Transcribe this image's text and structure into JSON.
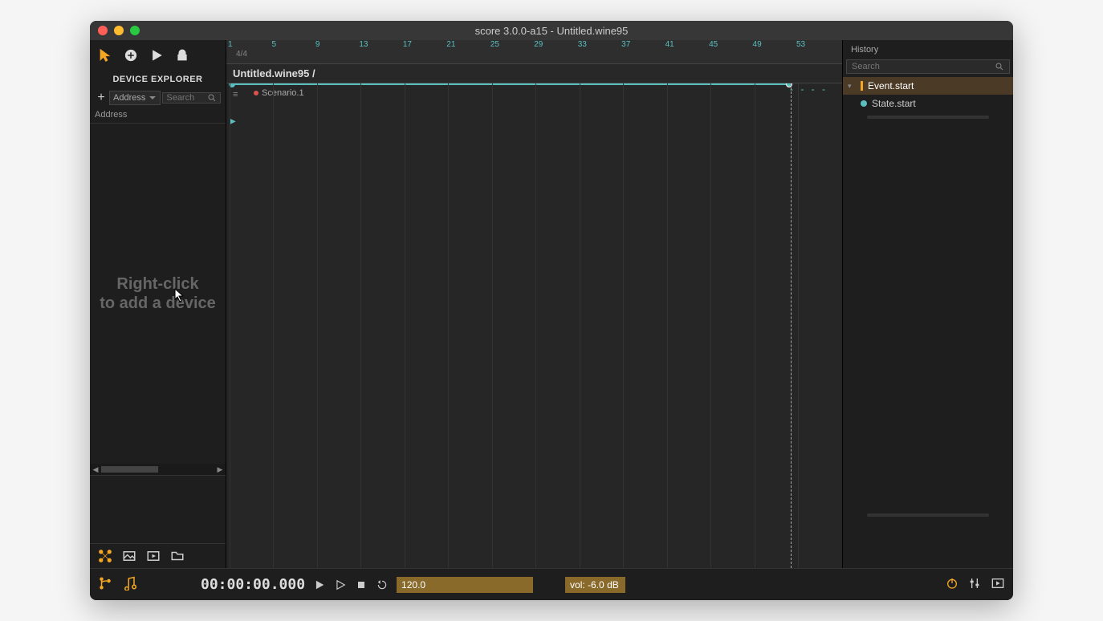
{
  "window": {
    "title": "score 3.0.0-a15 - Untitled.wine95"
  },
  "left": {
    "panel_title": "DEVICE EXPLORER",
    "address_label": "Address",
    "address_header": "Address",
    "search_placeholder": "Search",
    "hint_line1": "Right-click",
    "hint_line2": "to add a device"
  },
  "timeline": {
    "time_sig": "4/4",
    "ruler_ticks": [
      "1",
      "5",
      "9",
      "13",
      "17",
      "21",
      "25",
      "29",
      "33",
      "37",
      "41",
      "45",
      "49",
      "53"
    ],
    "title": "Untitled.wine95 /",
    "scenario_label": "Scenario.1"
  },
  "right": {
    "header": "History",
    "search_placeholder": "Search",
    "item1": "Event.start",
    "item2": "State.start"
  },
  "transport": {
    "time": "00:00:00.000",
    "tempo": "120.0",
    "vol": "vol: -6.0 dB"
  }
}
